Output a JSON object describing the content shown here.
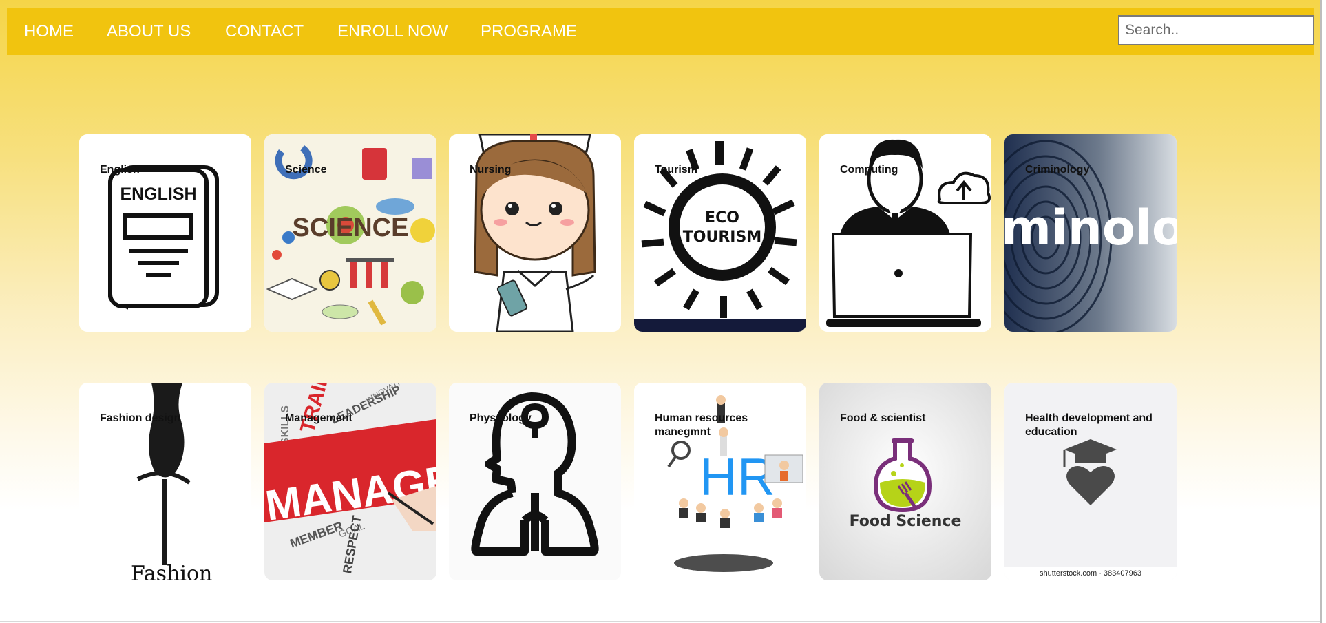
{
  "nav": {
    "items": [
      "HOME",
      "ABOUT US",
      "CONTACT",
      "ENROLL NOW",
      "PROGRAME"
    ],
    "search_placeholder": "Search.."
  },
  "courses": [
    {
      "label": "English",
      "image_text": "ENGLISH",
      "icon": "book-icon"
    },
    {
      "label": "Science",
      "image_text": "SCIENCE",
      "icon": "science-illustration"
    },
    {
      "label": "Nursing",
      "icon": "nurse-illustration"
    },
    {
      "label": "Tourism",
      "image_text": "ECO TOURISM",
      "icon": "globe-people-illustration"
    },
    {
      "label": "Computing",
      "icon": "person-laptop-icon"
    },
    {
      "label": "Criminology",
      "image_text": "minolo",
      "icon": "fingerprint-image"
    },
    {
      "label": "Fashion design",
      "image_text": "Fashion",
      "icon": "dress-form-icon"
    },
    {
      "label": "Management",
      "image_text": "MANAGEMENT",
      "icon": "word-cloud-image"
    },
    {
      "label": "Physcology",
      "icon": "head-lungs-icon"
    },
    {
      "label": "Human resources manegmnt",
      "image_text": "HR",
      "icon": "hr-people-illustration"
    },
    {
      "label": "Food & scientist",
      "image_text": "Food Science",
      "icon": "flask-fork-icon"
    },
    {
      "label": "Health development and education",
      "icon": "graduation-heart-icon",
      "watermark": "shutterstock.com · 383407963"
    }
  ],
  "colors": {
    "navbar": "#f1c40f",
    "nav_text": "#ffffff",
    "page_gradient_top": "#f5d548",
    "management_red": "#d9262c",
    "hr_blue": "#2196f3",
    "food_green": "#b6d318",
    "food_purple": "#7a2f7a"
  }
}
